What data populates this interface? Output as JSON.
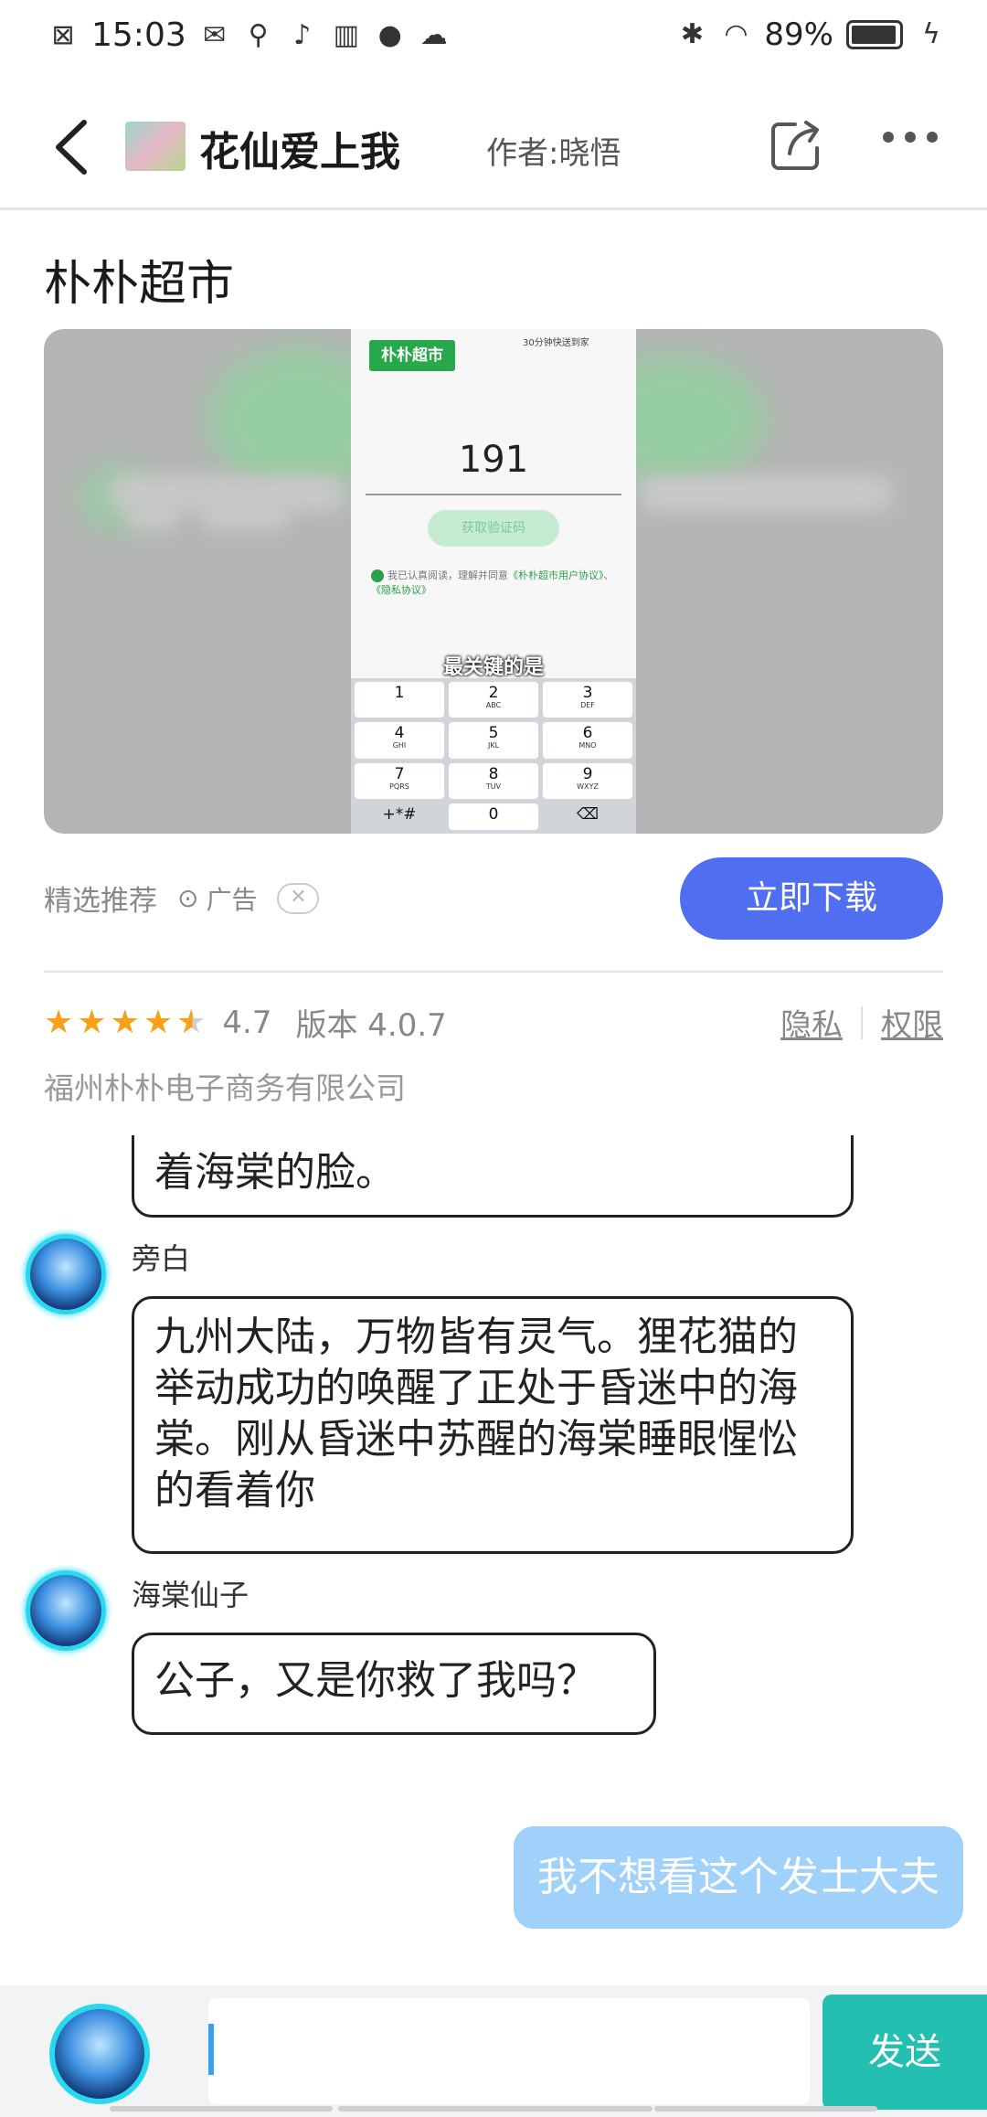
{
  "status_bar": {
    "time": "15:03",
    "battery": "89%",
    "icons_left": [
      "no-sim-icon",
      "sms-icon",
      "usb-icon",
      "tiktok-icon",
      "book-icon",
      "podcast-icon",
      "cloud-icon"
    ],
    "icons_right": [
      "bluetooth-icon",
      "wifi-icon",
      "battery-icon",
      "charging-icon"
    ]
  },
  "header": {
    "title": "花仙爱上我",
    "author": "作者:晓悟"
  },
  "ad": {
    "title": "朴朴超市",
    "screen": {
      "logo": "朴朴超市",
      "logo_sub": "30分钟快送到家",
      "phone_value": "191",
      "code_button": "获取验证码",
      "agree_text": "我已认真阅读，理解并同意",
      "agree_link1": "《朴朴超市用户协议》",
      "agree_sep": "、",
      "agree_link2": "《隐私协议》",
      "caption": "最关键的是",
      "keys": [
        {
          "d": "1",
          "l": ""
        },
        {
          "d": "2",
          "l": "ABC"
        },
        {
          "d": "3",
          "l": "DEF"
        },
        {
          "d": "4",
          "l": "GHI"
        },
        {
          "d": "5",
          "l": "JKL"
        },
        {
          "d": "6",
          "l": "MNO"
        },
        {
          "d": "7",
          "l": "PQRS"
        },
        {
          "d": "8",
          "l": "TUV"
        },
        {
          "d": "9",
          "l": "WXYZ"
        },
        {
          "d": "+*#",
          "l": ""
        },
        {
          "d": "0",
          "l": ""
        },
        {
          "d": "⌫",
          "l": ""
        }
      ]
    },
    "recommend_label": "精选推荐",
    "ad_label": "广告",
    "download_button": "立即下载",
    "rating": 4.7,
    "rating_text": "4.7",
    "version_text": "版本 4.0.7",
    "privacy_link": "隐私",
    "permission_link": "权限",
    "company": "福州朴朴电子商务有限公司",
    "accent_color": "#4f6ef0"
  },
  "chat": {
    "messages": [
      {
        "speaker": "",
        "text": "着海棠的脸。"
      },
      {
        "speaker": "旁白",
        "text": "九州大陆，万物皆有灵气。狸花猫的举动成功的唤醒了正处于昏迷中的海棠。刚从昏迷中苏醒的海棠睡眼惺忪的看着你"
      },
      {
        "speaker": "海棠仙子",
        "text": "公子，又是你救了我吗？"
      }
    ],
    "user_message": "我不想看这个发士大夫"
  },
  "input_bar": {
    "placeholder": "",
    "send_button": "发送",
    "send_color": "#23bfb0"
  }
}
